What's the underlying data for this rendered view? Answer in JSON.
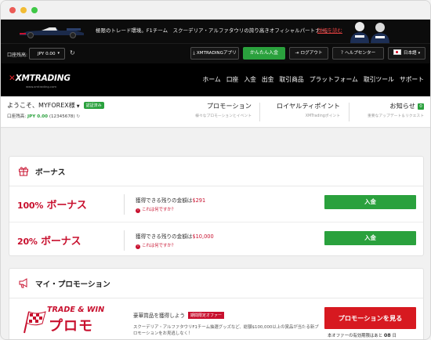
{
  "banner": {
    "text": "極限のトレード環境。F1チーム　スクーデリア・アルファタウリの誇り高きオフィシャルパートナー。",
    "link": "詳細を読む"
  },
  "account_bar": {
    "label": "口座残高:",
    "currency": "JPY 0.00",
    "buttons": [
      "XMTRADINGアプリ",
      "かんたん入金",
      "ログアウト",
      "ヘルプセンター",
      "日本語"
    ]
  },
  "nav": {
    "logo": "XMTRADING",
    "logo_sub": "www.xmtrading.com",
    "links": [
      "ホーム",
      "口座",
      "入金",
      "出金",
      "取引商品",
      "プラットフォーム",
      "取引ツール",
      "サポート"
    ]
  },
  "user": {
    "welcome": "ようこそ、MYFOREX様",
    "verified": "認証済み",
    "account_prefix": "口座残高: ",
    "balance": "JPY 0.00",
    "account_id": "(12345678)",
    "promotion_title": "プロモーション",
    "promotion_sub": "様々なプロモーションとイベント",
    "loyalty_title": "ロイヤルティポイント",
    "loyalty_sub": "XMTradingポイント",
    "news_title": "お知らせ",
    "news_count": "0",
    "news_sub": "重要なアップデート＆リクエスト"
  },
  "bonus": {
    "title": "ボーナス",
    "rows": [
      {
        "pct": "100%",
        "name": "ボーナス",
        "text": "獲得できる残りの金額は",
        "amount": "$291",
        "help": "これは何ですか？",
        "button": "入金"
      },
      {
        "pct": "20%",
        "name": "ボーナス",
        "text": "獲得できる残りの金額は",
        "amount": "$10,000",
        "help": "これは何ですか？",
        "button": "入金"
      }
    ]
  },
  "my_promo": {
    "title": "マイ・プロモーション",
    "logo_top": "TRADE & WIN",
    "logo_main": "プロモ",
    "heading": "豪華賞品を獲得しよう",
    "tag": "期間限定オファー",
    "desc": "スクーデリア・アルファタウリF1チーム抽選グッズなど、総額$100,000以上の賞品が当たる新プロモーションをお見逃しなく！",
    "button": "プロモーションを見る",
    "expiry_text": "本オファーの有効期限はあと",
    "expiry_days": "08",
    "expiry_unit": "日"
  },
  "colors": {
    "accent_green": "#2aa13d",
    "accent_red": "#c8102e",
    "header_bg": "#000000"
  }
}
